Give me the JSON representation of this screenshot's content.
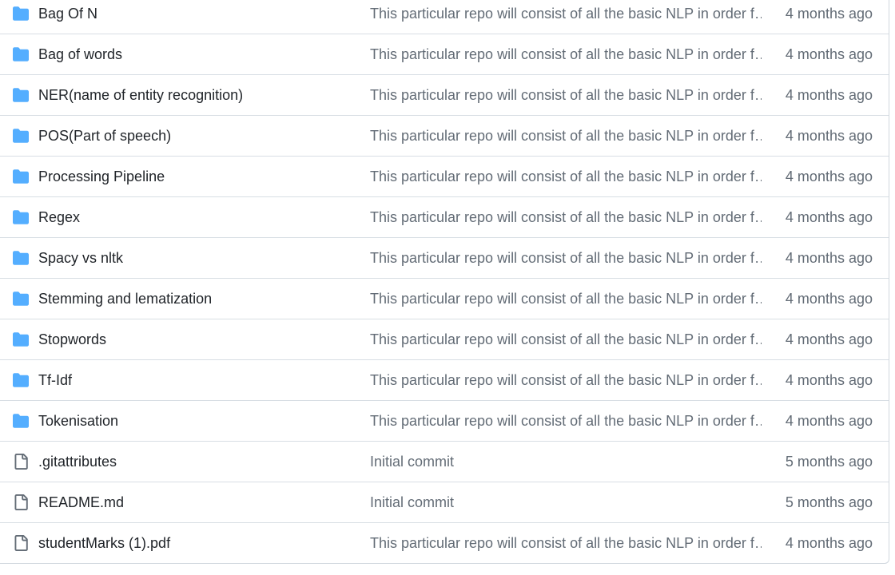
{
  "colors": {
    "folder_icon": "#54aeff",
    "file_icon": "#636c76",
    "name_text": "#1f2328",
    "muted_text": "#636c76",
    "border": "#d8dee4"
  },
  "rows": [
    {
      "type": "folder",
      "icon": "folder-icon",
      "name": "Bag Of N",
      "message": "This particular repo will consist of all the basic NLP in order f…",
      "age": "4 months ago"
    },
    {
      "type": "folder",
      "icon": "folder-icon",
      "name": "Bag of words",
      "message": "This particular repo will consist of all the basic NLP in order f…",
      "age": "4 months ago"
    },
    {
      "type": "folder",
      "icon": "folder-icon",
      "name": "NER(name of entity recognition)",
      "message": "This particular repo will consist of all the basic NLP in order f…",
      "age": "4 months ago"
    },
    {
      "type": "folder",
      "icon": "folder-icon",
      "name": "POS(Part of speech)",
      "message": "This particular repo will consist of all the basic NLP in order f…",
      "age": "4 months ago"
    },
    {
      "type": "folder",
      "icon": "folder-icon",
      "name": "Processing Pipeline",
      "message": "This particular repo will consist of all the basic NLP in order f…",
      "age": "4 months ago"
    },
    {
      "type": "folder",
      "icon": "folder-icon",
      "name": "Regex",
      "message": "This particular repo will consist of all the basic NLP in order f…",
      "age": "4 months ago"
    },
    {
      "type": "folder",
      "icon": "folder-icon",
      "name": "Spacy vs nltk",
      "message": "This particular repo will consist of all the basic NLP in order f…",
      "age": "4 months ago"
    },
    {
      "type": "folder",
      "icon": "folder-icon",
      "name": "Stemming and lematization",
      "message": "This particular repo will consist of all the basic NLP in order f…",
      "age": "4 months ago"
    },
    {
      "type": "folder",
      "icon": "folder-icon",
      "name": "Stopwords",
      "message": "This particular repo will consist of all the basic NLP in order f…",
      "age": "4 months ago"
    },
    {
      "type": "folder",
      "icon": "folder-icon",
      "name": "Tf-Idf",
      "message": "This particular repo will consist of all the basic NLP in order f…",
      "age": "4 months ago"
    },
    {
      "type": "folder",
      "icon": "folder-icon",
      "name": "Tokenisation",
      "message": "This particular repo will consist of all the basic NLP in order f…",
      "age": "4 months ago"
    },
    {
      "type": "file",
      "icon": "file-icon",
      "name": ".gitattributes",
      "message": "Initial commit",
      "age": "5 months ago"
    },
    {
      "type": "file",
      "icon": "file-icon",
      "name": "README.md",
      "message": "Initial commit",
      "age": "5 months ago"
    },
    {
      "type": "file",
      "icon": "file-icon",
      "name": "studentMarks (1).pdf",
      "message": "This particular repo will consist of all the basic NLP in order f…",
      "age": "4 months ago"
    }
  ]
}
